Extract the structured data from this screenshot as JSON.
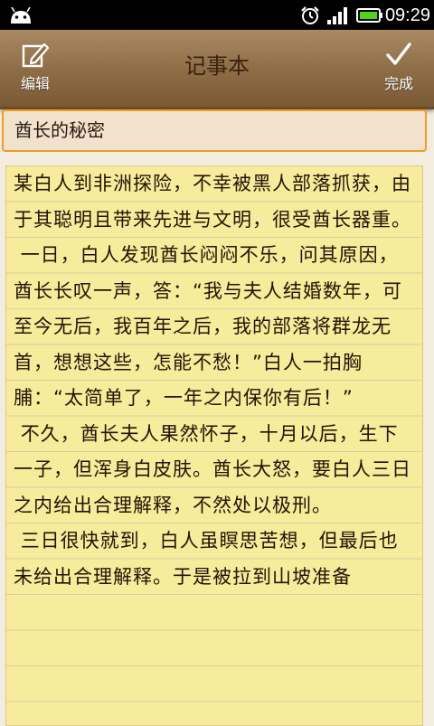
{
  "status_bar": {
    "time": "09:29",
    "icons": [
      "android-icon",
      "alarm-icon",
      "signal-icon",
      "battery-icon"
    ]
  },
  "header": {
    "edit_label": "编辑",
    "title": "记事本",
    "done_label": "完成"
  },
  "note": {
    "title": "酋长的秘密",
    "body": "某白人到非洲探险，不幸被黑人部落抓获，由于其聪明且带来先进与文明，很受酋长器重。\n 一日，白人发现酋长闷闷不乐，问其原因，酋长长叹一声，答：“我与夫人结婚数年，可至今无后，我百年之后，我的部落将群龙无首，想想这些，怎能不愁！”白人一拍胸脯：“太简单了，一年之内保你有后！”\n 不久，酋长夫人果然怀子，十月以后，生下一子，但浑身白皮肤。酋长大怒，要白人三日之内给出合理解释，不然处以极刑。\n 三日很快就到，白人虽瞑思苦想，但最后也未给出合理解释。于是被拉到山坡准备"
  },
  "colors": {
    "header_bg": "#8d6c45",
    "title_border": "#f39a24",
    "note_bg": "#f7eb9c"
  }
}
